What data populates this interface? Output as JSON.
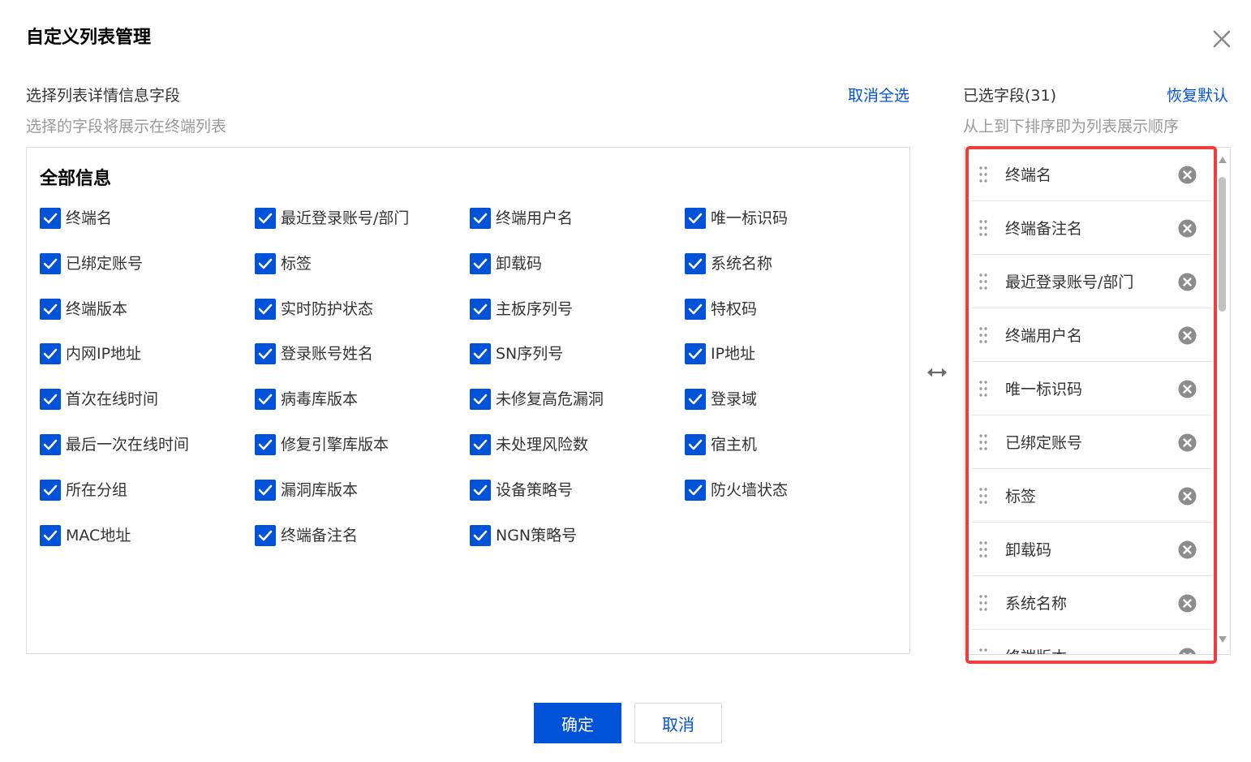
{
  "dialog": {
    "title": "自定义列表管理",
    "confirm_label": "确定",
    "cancel_label": "取消"
  },
  "left": {
    "title": "选择列表详情信息字段",
    "subtitle": "选择的字段将展示在终端列表",
    "deselect_all": "取消全选",
    "group_title": "全部信息",
    "fields": [
      {
        "label": "终端名",
        "checked": true
      },
      {
        "label": "最近登录账号/部门",
        "checked": true
      },
      {
        "label": "终端用户名",
        "checked": true
      },
      {
        "label": "唯一标识码",
        "checked": true
      },
      {
        "label": "已绑定账号",
        "checked": true
      },
      {
        "label": "标签",
        "checked": true
      },
      {
        "label": "卸载码",
        "checked": true
      },
      {
        "label": "系统名称",
        "checked": true
      },
      {
        "label": "终端版本",
        "checked": true
      },
      {
        "label": "实时防护状态",
        "checked": true
      },
      {
        "label": "主板序列号",
        "checked": true
      },
      {
        "label": "特权码",
        "checked": true
      },
      {
        "label": "内网IP地址",
        "checked": true
      },
      {
        "label": "登录账号姓名",
        "checked": true
      },
      {
        "label": "SN序列号",
        "checked": true
      },
      {
        "label": "IP地址",
        "checked": true
      },
      {
        "label": "首次在线时间",
        "checked": true
      },
      {
        "label": "病毒库版本",
        "checked": true
      },
      {
        "label": "未修复高危漏洞",
        "checked": true
      },
      {
        "label": "登录域",
        "checked": true
      },
      {
        "label": "最后一次在线时间",
        "checked": true
      },
      {
        "label": "修复引擎库版本",
        "checked": true
      },
      {
        "label": "未处理风险数",
        "checked": true
      },
      {
        "label": "宿主机",
        "checked": true
      },
      {
        "label": "所在分组",
        "checked": true
      },
      {
        "label": "漏洞库版本",
        "checked": true
      },
      {
        "label": "设备策略号",
        "checked": true
      },
      {
        "label": "防火墙状态",
        "checked": true
      },
      {
        "label": "MAC地址",
        "checked": true
      },
      {
        "label": "终端备注名",
        "checked": true
      },
      {
        "label": "NGN策略号",
        "checked": true
      }
    ]
  },
  "right": {
    "title": "已选字段(31)",
    "subtitle": "从上到下排序即为列表展示顺序",
    "restore_default": "恢复默认",
    "selected": [
      "终端名",
      "终端备注名",
      "最近登录账号/部门",
      "终端用户名",
      "唯一标识码",
      "已绑定账号",
      "标签",
      "卸载码",
      "系统名称",
      "终端版本"
    ]
  },
  "colors": {
    "accent": "#0052d9",
    "highlight": "#f03c3c"
  },
  "icons": [
    "close-icon",
    "check-icon",
    "swap-arrows-icon",
    "drag-handle-icon",
    "remove-circle-icon",
    "scroll-up-arrow-icon",
    "scroll-down-arrow-icon"
  ]
}
